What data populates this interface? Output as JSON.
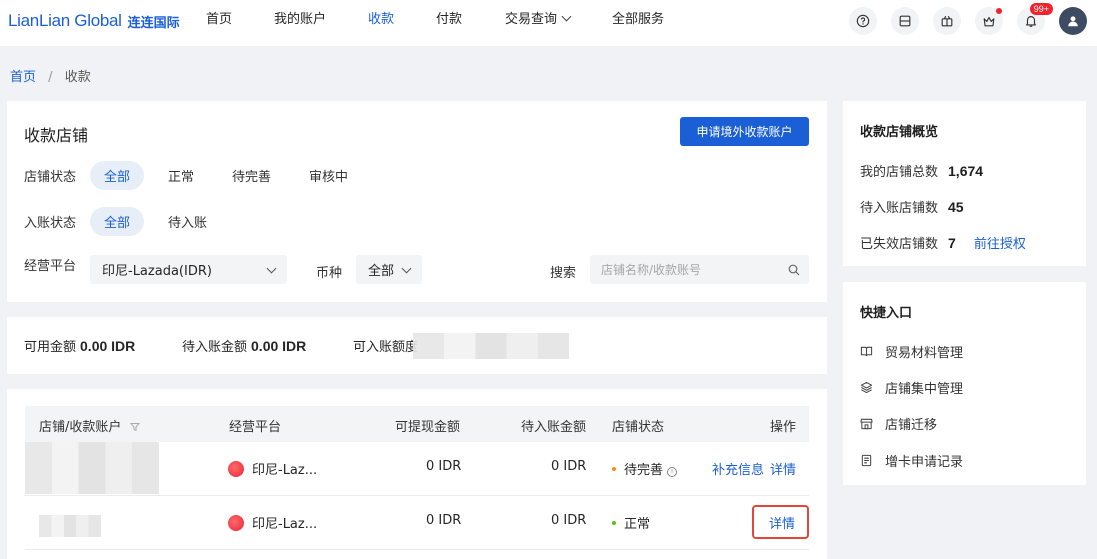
{
  "header": {
    "logo_en": "LianLian Global",
    "logo_cn": "连连国际",
    "nav": [
      {
        "label": "首页"
      },
      {
        "label": "我的账户"
      },
      {
        "label": "收款"
      },
      {
        "label": "付款"
      },
      {
        "label": "交易查询"
      },
      {
        "label": "全部服务"
      }
    ],
    "notification_badge": "99+"
  },
  "breadcrumb": {
    "home": "首页",
    "separator": "/",
    "current": "收款"
  },
  "store_card": {
    "title": "收款店铺",
    "apply_button": "申请境外收款账户",
    "store_status": {
      "label": "店铺状态",
      "options": [
        "全部",
        "正常",
        "待完善",
        "审核中"
      ]
    },
    "credit_status": {
      "label": "入账状态",
      "options": [
        "全部",
        "待入账"
      ]
    },
    "platform": {
      "label": "经营平台",
      "value": "印尼-Lazada(IDR)"
    },
    "currency": {
      "label": "币种",
      "value": "全部"
    },
    "search": {
      "label": "搜索",
      "placeholder": "店铺名称/收款账号"
    }
  },
  "balance": {
    "available_label": "可用金额",
    "available_value": "0.00 IDR",
    "pending_label": "待入账金额",
    "pending_value": "0.00 IDR",
    "limit_label": "可入账额度"
  },
  "table": {
    "headers": {
      "store": "店铺/收款账户",
      "platform": "经营平台",
      "withdrawable": "可提现金额",
      "pending": "待入账金额",
      "status": "店铺状态",
      "actions": "操作"
    },
    "rows": [
      {
        "platform": "印尼-Laz...",
        "withdrawable": "0 IDR",
        "pending": "0 IDR",
        "status": "待完善",
        "status_color": "#fa8c16",
        "action_supplement": "补充信息",
        "action_detail": "详情"
      },
      {
        "platform": "印尼-Laz...",
        "withdrawable": "0 IDR",
        "pending": "0 IDR",
        "status": "正常",
        "status_color": "#52c41a",
        "action_detail": "详情"
      }
    ]
  },
  "overview": {
    "title": "收款店铺概览",
    "total_label": "我的店铺总数",
    "total_value": "1,674",
    "pending_label": "待入账店铺数",
    "pending_value": "45",
    "expired_label": "已失效店铺数",
    "expired_value": "7",
    "authorize_link": "前往授权"
  },
  "shortcuts": {
    "title": "快捷入口",
    "items": [
      {
        "label": "贸易材料管理",
        "icon": "book-icon"
      },
      {
        "label": "店铺集中管理",
        "icon": "layers-icon"
      },
      {
        "label": "店铺迁移",
        "icon": "store-icon"
      },
      {
        "label": "增卡申请记录",
        "icon": "document-icon"
      }
    ]
  }
}
